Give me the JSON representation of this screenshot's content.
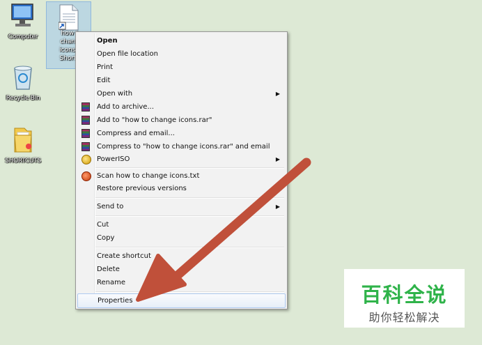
{
  "desktop": {
    "icons": [
      {
        "label": "Computer"
      },
      {
        "label": "Recycle Bin"
      },
      {
        "label": "SHORTCUTS"
      }
    ],
    "selected_file": {
      "label": "how t\nchang\nicons.t\nShortc"
    }
  },
  "context_menu": {
    "items": [
      {
        "label": "Open",
        "bold": true
      },
      {
        "label": "Open file location"
      },
      {
        "label": "Print"
      },
      {
        "label": "Edit"
      },
      {
        "label": "Open with",
        "submenu": true
      },
      {
        "label": "Add to archive...",
        "icon": "winrar-icon"
      },
      {
        "label": "Add to \"how to change icons.rar\"",
        "icon": "winrar-icon"
      },
      {
        "label": "Compress and email...",
        "icon": "winrar-icon"
      },
      {
        "label": "Compress to \"how to change icons.rar\" and email",
        "icon": "winrar-icon"
      },
      {
        "label": "PowerISO",
        "icon": "poweriso-icon",
        "submenu": true
      },
      {
        "label": "Scan how to change icons.txt",
        "icon": "antivirus-icon"
      },
      {
        "label": "Restore previous versions"
      },
      {
        "label": "Send to",
        "submenu": true
      },
      {
        "label": "Cut"
      },
      {
        "label": "Copy"
      },
      {
        "label": "Create shortcut"
      },
      {
        "label": "Delete"
      },
      {
        "label": "Rename"
      },
      {
        "label": "Properties",
        "highlighted": true
      }
    ]
  },
  "watermark": {
    "title": "百科全说",
    "subtitle": "助你轻松解决",
    "title_color": "#2fb34a"
  },
  "arrow_color": "#c0503a"
}
